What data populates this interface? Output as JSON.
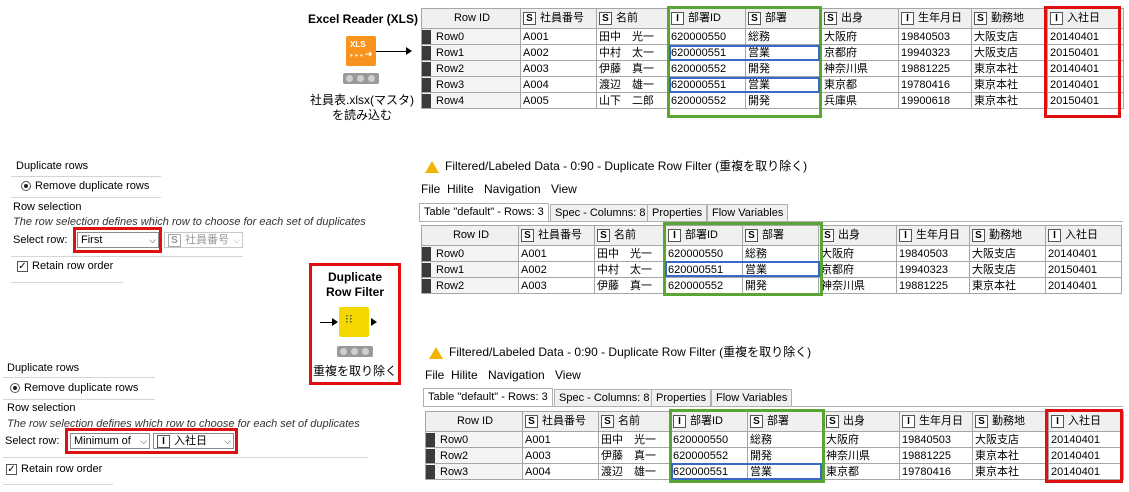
{
  "reader_node": {
    "title": "Excel Reader (XLS)",
    "icon_text": "XLS",
    "caption_line1": "社員表.xlsx(マスタ)",
    "caption_line2": "を読み込む"
  },
  "input_table": {
    "headers": [
      {
        "type": "",
        "label": "Row ID"
      },
      {
        "type": "S",
        "label": "社員番号"
      },
      {
        "type": "S",
        "label": "名前"
      },
      {
        "type": "I",
        "label": "部署ID"
      },
      {
        "type": "S",
        "label": "部署"
      },
      {
        "type": "S",
        "label": "出身"
      },
      {
        "type": "I",
        "label": "生年月日"
      },
      {
        "type": "S",
        "label": "勤務地"
      },
      {
        "type": "I",
        "label": "入社日"
      }
    ],
    "rows": [
      [
        "Row0",
        "A001",
        "田中　光一",
        "620000550",
        "総務",
        "大阪府",
        "19840503",
        "大阪支店",
        "20140401"
      ],
      [
        "Row1",
        "A002",
        "中村　太一",
        "620000551",
        "営業",
        "京都府",
        "19940323",
        "大阪支店",
        "20150401"
      ],
      [
        "Row2",
        "A003",
        "伊藤　真一",
        "620000552",
        "開発",
        "神奈川県",
        "19881225",
        "東京本社",
        "20140401"
      ],
      [
        "Row3",
        "A004",
        "渡辺　雄一",
        "620000551",
        "営業",
        "東京都",
        "19780416",
        "東京本社",
        "20140401"
      ],
      [
        "Row4",
        "A005",
        "山下　二郎",
        "620000552",
        "開発",
        "兵庫県",
        "19900618",
        "東京本社",
        "20150401"
      ]
    ]
  },
  "config_first": {
    "group_duplicate": "Duplicate rows",
    "radio_label": "Remove duplicate rows",
    "group_selection": "Row selection",
    "description": "The row selection defines which row to choose for each set of duplicates",
    "select_label": "Select row:",
    "select_value": "First",
    "column_value": "社員番号",
    "column_type": "S",
    "retain_label": "Retain row order"
  },
  "config_min": {
    "group_duplicate": "Duplicate rows",
    "radio_label": "Remove duplicate rows",
    "group_selection": "Row selection",
    "description": "The row selection defines which row to choose for each set of duplicates",
    "select_label": "Select row:",
    "select_value": "Minimum of",
    "column_value": "入社日",
    "column_type": "I",
    "retain_label": "Retain row order"
  },
  "dup_node": {
    "title_line1": "Duplicate",
    "title_line2": "Row Filter",
    "caption": "重複を取り除く"
  },
  "output1": {
    "title": "Filtered/Labeled Data - 0:90 - Duplicate Row Filter (重複を取り除く)",
    "menu": [
      "File",
      "Hilite",
      "Navigation",
      "View"
    ],
    "tabs": [
      "Table \"default\" - Rows: 3",
      "Spec - Columns: 8",
      "Properties",
      "Flow Variables"
    ],
    "rows": [
      [
        "Row0",
        "A001",
        "田中　光一",
        "620000550",
        "総務",
        "大阪府",
        "19840503",
        "大阪支店",
        "20140401"
      ],
      [
        "Row1",
        "A002",
        "中村　太一",
        "620000551",
        "営業",
        "京都府",
        "19940323",
        "大阪支店",
        "20150401"
      ],
      [
        "Row2",
        "A003",
        "伊藤　真一",
        "620000552",
        "開発",
        "神奈川県",
        "19881225",
        "東京本社",
        "20140401"
      ]
    ]
  },
  "output2": {
    "title": "Filtered/Labeled Data - 0:90 - Duplicate Row Filter (重複を取り除く)",
    "menu": [
      "File",
      "Hilite",
      "Navigation",
      "View"
    ],
    "tabs": [
      "Table \"default\" - Rows: 3",
      "Spec - Columns: 8",
      "Properties",
      "Flow Variables"
    ],
    "rows": [
      [
        "Row0",
        "A001",
        "田中　光一",
        "620000550",
        "総務",
        "大阪府",
        "19840503",
        "大阪支店",
        "20140401"
      ],
      [
        "Row2",
        "A003",
        "伊藤　真一",
        "620000552",
        "開発",
        "神奈川県",
        "19881225",
        "東京本社",
        "20140401"
      ],
      [
        "Row3",
        "A004",
        "渡辺　雄一",
        "620000551",
        "営業",
        "東京都",
        "19780416",
        "東京本社",
        "20140401"
      ]
    ]
  },
  "colors": {
    "red_highlight": "#e01010",
    "green_highlight": "#5aa632",
    "blue_highlight": "#3a68c8",
    "reader_node": "#f7931e",
    "filter_node": "#f5d800"
  }
}
